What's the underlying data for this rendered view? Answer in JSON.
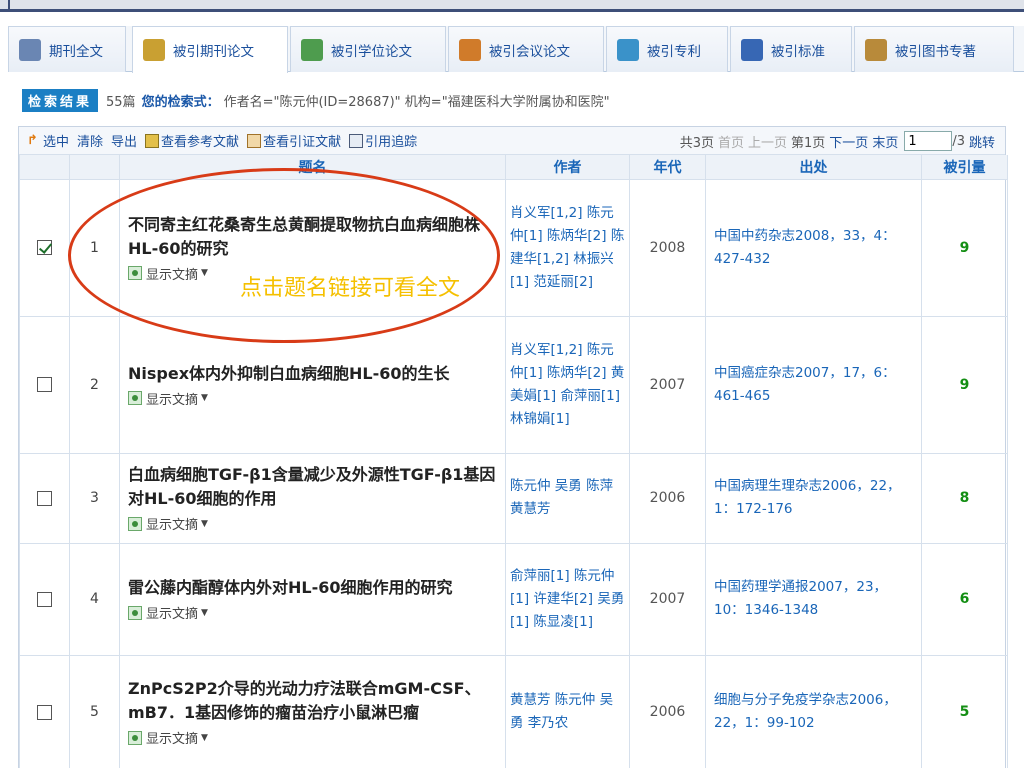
{
  "tabs": [
    {
      "label": "期刊全文",
      "icon": "journal-icon",
      "color": "#6a86b3"
    },
    {
      "label": "被引期刊论文",
      "icon": "journal-stack-icon",
      "color": "#c9a032"
    },
    {
      "label": "被引学位论文",
      "icon": "thesis-book-icon",
      "color": "#4e9c4e"
    },
    {
      "label": "被引会议论文",
      "icon": "conference-icon",
      "color": "#d07b2a"
    },
    {
      "label": "被引专利",
      "icon": "patent-icon",
      "color": "#3a92c9"
    },
    {
      "label": "被引标准",
      "icon": "standard-icon",
      "color": "#3767b4"
    },
    {
      "label": "被引图书专著",
      "icon": "book-icon",
      "color": "#b88a3a"
    }
  ],
  "results": {
    "badge": "检索结果",
    "count": "55篇",
    "query_label": "您的检索式：",
    "query": "作者名=\"陈元仲(ID=28687)\" 机构=\"福建医科大学附属协和医院\""
  },
  "toolbar": {
    "items": [
      {
        "label": "选中",
        "icon": "select-arrow-icon"
      },
      {
        "label": "清除",
        "icon": ""
      },
      {
        "label": "导出",
        "icon": ""
      },
      {
        "label": "查看参考文献",
        "icon": "reference-icon"
      },
      {
        "label": "查看引证文献",
        "icon": "citation-icon"
      },
      {
        "label": "引用追踪",
        "icon": "tracking-icon"
      }
    ]
  },
  "pager": {
    "total": "共3页",
    "first": "首页",
    "prev": "上一页",
    "current": "第1页",
    "next": "下一页",
    "last": "末页",
    "page_input": "1",
    "of_total": "/3",
    "go": "跳转"
  },
  "columns": {
    "title": "题名",
    "author": "作者",
    "year": "年代",
    "source": "出处",
    "cited": "被引量"
  },
  "abstract_label": "显示文摘",
  "rows": [
    {
      "num": "1",
      "checked": true,
      "title": "不同寄主红花桑寄生总黄酮提取物抗白血病细胞株HL-60的研究",
      "authors": "肖义军[1,2] 陈元仲[1] 陈炳华[2] 陈建华[1,2] 林振兴[1] 范延丽[2]",
      "year": "2008",
      "source": "中国中药杂志2008，33，4：427-432",
      "cited": "9"
    },
    {
      "num": "2",
      "checked": false,
      "title": "Nispex体内外抑制白血病细胞HL-60的生长",
      "authors": "肖义军[1,2] 陈元仲[1] 陈炳华[2] 黄美娟[1] 俞萍丽[1] 林锦娟[1]",
      "year": "2007",
      "source": "中国癌症杂志2007，17，6：461-465",
      "cited": "9"
    },
    {
      "num": "3",
      "checked": false,
      "title": "白血病细胞TGF-β1含量减少及外源性TGF-β1基因对HL-60细胞的作用",
      "authors": "陈元仲 吴勇 陈萍 黄慧芳",
      "year": "2006",
      "source": "中国病理生理杂志2006，22，1：172-176",
      "cited": "8"
    },
    {
      "num": "4",
      "checked": false,
      "title": "雷公藤内酯醇体内外对HL-60细胞作用的研究",
      "authors": "俞萍丽[1] 陈元仲[1] 许建华[2] 吴勇[1] 陈显凌[1]",
      "year": "2007",
      "source": "中国药理学通报2007，23，10：1346-1348",
      "cited": "6"
    },
    {
      "num": "5",
      "checked": false,
      "title": "ZnPcS2P2介导的光动力疗法联合mGM-CSF、mB7．1基因修饰的瘤苗治疗小鼠淋巴瘤",
      "authors": "黄慧芳 陈元仲 吴勇 李乃农",
      "year": "2006",
      "source": "细胞与分子免疫学杂志2006，22，1：99-102",
      "cited": "5"
    }
  ],
  "annotation": "点击题名链接可看全文"
}
